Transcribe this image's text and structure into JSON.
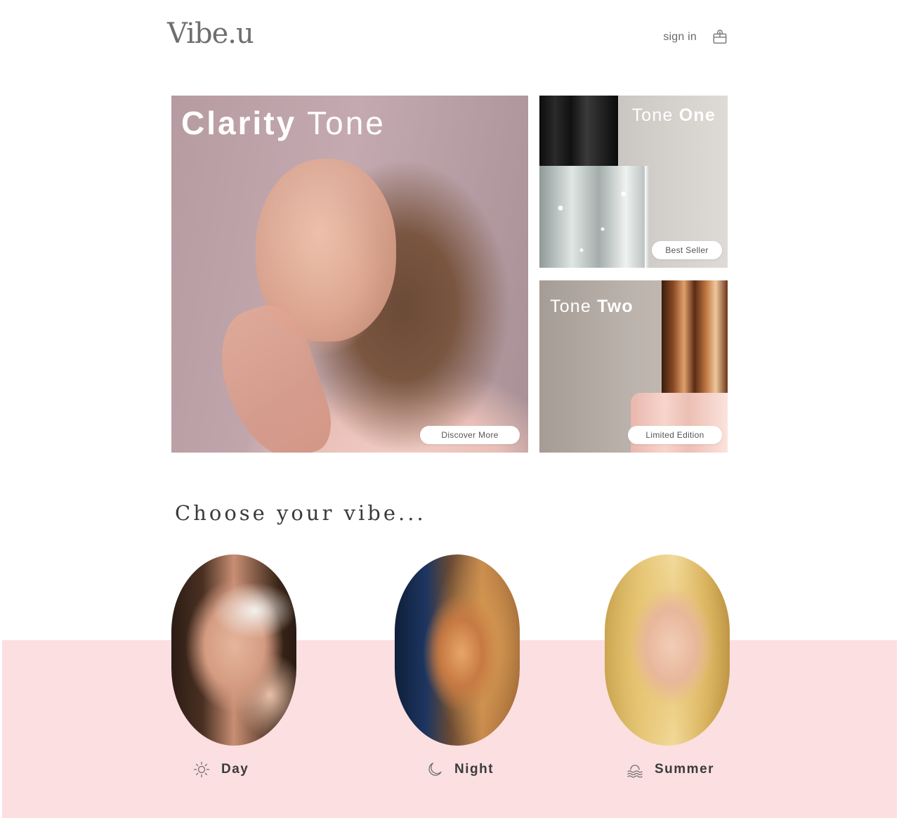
{
  "header": {
    "logo": "Vibe.u",
    "signin_label": "sign in",
    "cart_icon": "shopping-bag-icon"
  },
  "hero": {
    "main": {
      "title_bold": "Clarity",
      "title_light": "Tone",
      "button_label": "Discover More"
    },
    "tone_one": {
      "title_light": "Tone",
      "title_bold": "One",
      "badge_label": "Best Seller"
    },
    "tone_two": {
      "title_light": "Tone",
      "title_bold": "Two",
      "badge_label": "Limited Edition"
    }
  },
  "choose": {
    "title": "Choose your vibe...",
    "options": [
      {
        "label": "Day",
        "icon": "sun-icon"
      },
      {
        "label": "Night",
        "icon": "moon-icon"
      },
      {
        "label": "Summer",
        "icon": "sunset-waves-icon"
      }
    ]
  },
  "colors": {
    "accent_pink": "#fcdfe1",
    "text_dark": "#3b3b3b",
    "logo_gray": "#6e6e6e"
  }
}
